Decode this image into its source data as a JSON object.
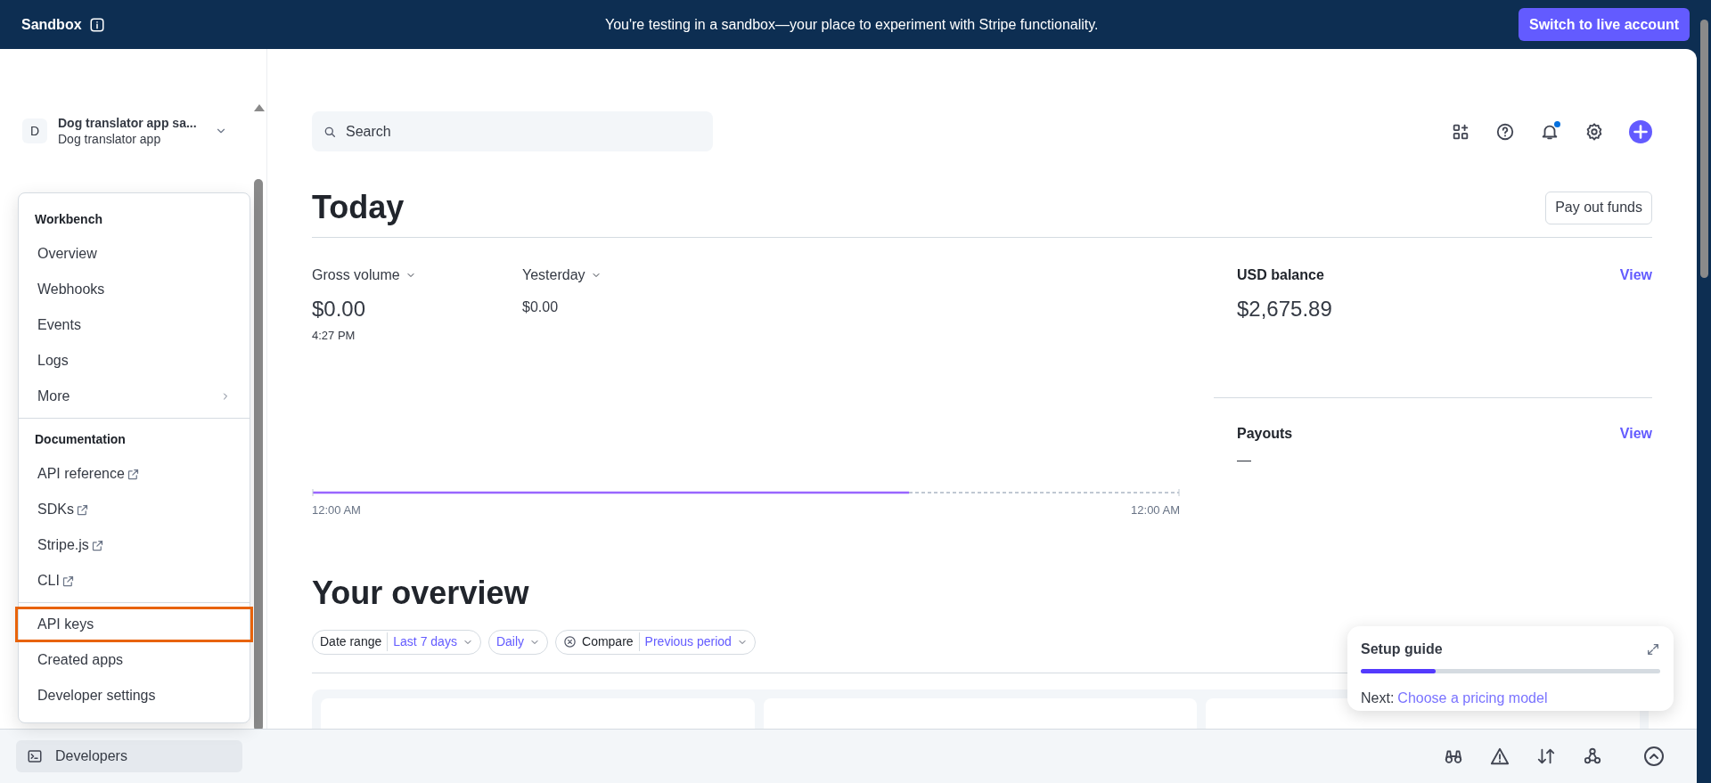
{
  "banner": {
    "label": "Sandbox",
    "message": "You're testing in a sandbox—your place to experiment with Stripe functionality.",
    "button": "Switch to live account"
  },
  "account": {
    "initial": "D",
    "name": "Dog translator app sa...",
    "subtitle": "Dog translator app"
  },
  "developer_menu": {
    "sections": [
      {
        "title": "Workbench",
        "items": [
          {
            "label": "Overview",
            "kind": "plain",
            "highlighted": false
          },
          {
            "label": "Webhooks",
            "kind": "plain",
            "highlighted": false
          },
          {
            "label": "Events",
            "kind": "plain",
            "highlighted": false
          },
          {
            "label": "Logs",
            "kind": "plain",
            "highlighted": false
          },
          {
            "label": "More",
            "kind": "submenu",
            "highlighted": false
          }
        ]
      },
      {
        "title": "Documentation",
        "items": [
          {
            "label": "API reference",
            "kind": "external",
            "highlighted": false
          },
          {
            "label": "SDKs",
            "kind": "external",
            "highlighted": false
          },
          {
            "label": "Stripe.js",
            "kind": "external",
            "highlighted": false
          },
          {
            "label": "CLI",
            "kind": "external",
            "highlighted": false
          }
        ]
      },
      {
        "items": [
          {
            "label": "API keys",
            "kind": "plain",
            "highlighted": true
          },
          {
            "label": "Created apps",
            "kind": "plain",
            "highlighted": false
          },
          {
            "label": "Developer settings",
            "kind": "plain",
            "highlighted": false
          }
        ]
      }
    ]
  },
  "search": {
    "placeholder": "Search"
  },
  "toolbar": {
    "notification_dot": true
  },
  "today": {
    "title": "Today",
    "button": "Pay out funds",
    "metrics": [
      {
        "label": "Gross volume",
        "value": "$0.00",
        "time": "4:27 PM"
      },
      {
        "label": "Yesterday",
        "value": "$0.00"
      }
    ],
    "chart": {
      "start_label": "12:00 AM",
      "end_label": "12:00 AM"
    },
    "side": [
      {
        "title": "USD balance",
        "value": "$2,675.89",
        "link": "View"
      },
      {
        "title": "Payouts",
        "value": "—",
        "link": "View"
      }
    ]
  },
  "overview": {
    "title": "Your overview",
    "filters": [
      {
        "label": "Date range",
        "value": "Last 7 days",
        "removable": false
      },
      {
        "value": "Daily",
        "removable": false
      },
      {
        "label": "Compare",
        "value": "Previous period",
        "removable": true
      }
    ]
  },
  "setup_guide": {
    "title": "Setup guide",
    "level": 0.25,
    "next_label": "Next:",
    "next_link": "Choose a pricing model"
  },
  "bottom_bar": {
    "button": "Developers"
  }
}
